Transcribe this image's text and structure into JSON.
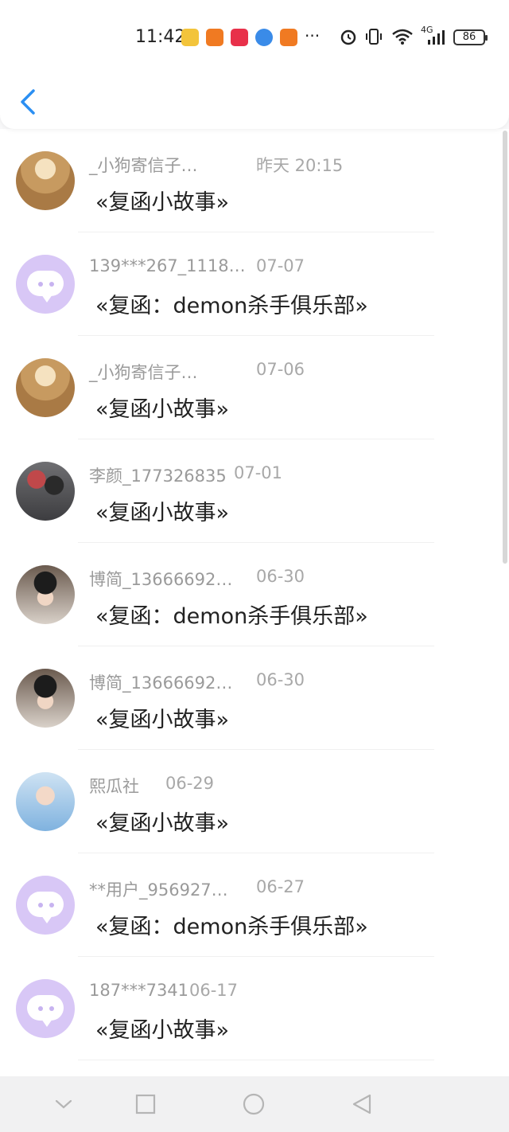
{
  "status_bar": {
    "time": "11:42",
    "network_label": "4G",
    "battery": "86",
    "dots": "···"
  },
  "header": {
    "back_icon": "chevron-left-icon"
  },
  "messages": [
    {
      "name": "_小狗寄信子…",
      "date": "昨天 20:15",
      "subject": "«复函小故事»",
      "avatar": "photo-girl-yellow"
    },
    {
      "name": "139***267_1118…",
      "date": "07-07",
      "subject": "«复函：demon杀手俱乐部»",
      "avatar": "default-chat"
    },
    {
      "name": "_小狗寄信子…",
      "date": "07-06",
      "subject": "«复函小故事»",
      "avatar": "photo-girl-yellow"
    },
    {
      "name": "李颜_177326835",
      "date": "07-01",
      "subject": "«复函小故事»",
      "avatar": "photo-two-people"
    },
    {
      "name": "博简_13666692…",
      "date": "06-30",
      "subject": "«复函：demon杀手俱乐部»",
      "avatar": "photo-boy-dark"
    },
    {
      "name": "博简_13666692…",
      "date": "06-30",
      "subject": "«复函小故事»",
      "avatar": "photo-boy-dark"
    },
    {
      "name": "熙瓜社",
      "date": "06-29",
      "subject": "«复函小故事»",
      "avatar": "photo-blue-kid"
    },
    {
      "name": "**用户_956927…",
      "date": "06-27",
      "subject": "«复函：demon杀手俱乐部»",
      "avatar": "default-chat"
    },
    {
      "name": "187***7341",
      "date": "06-17",
      "subject": "«复函小故事»",
      "avatar": "default-chat"
    }
  ],
  "colors": {
    "accent": "#2b8ff2",
    "default_avatar": "#d8c7f6"
  }
}
